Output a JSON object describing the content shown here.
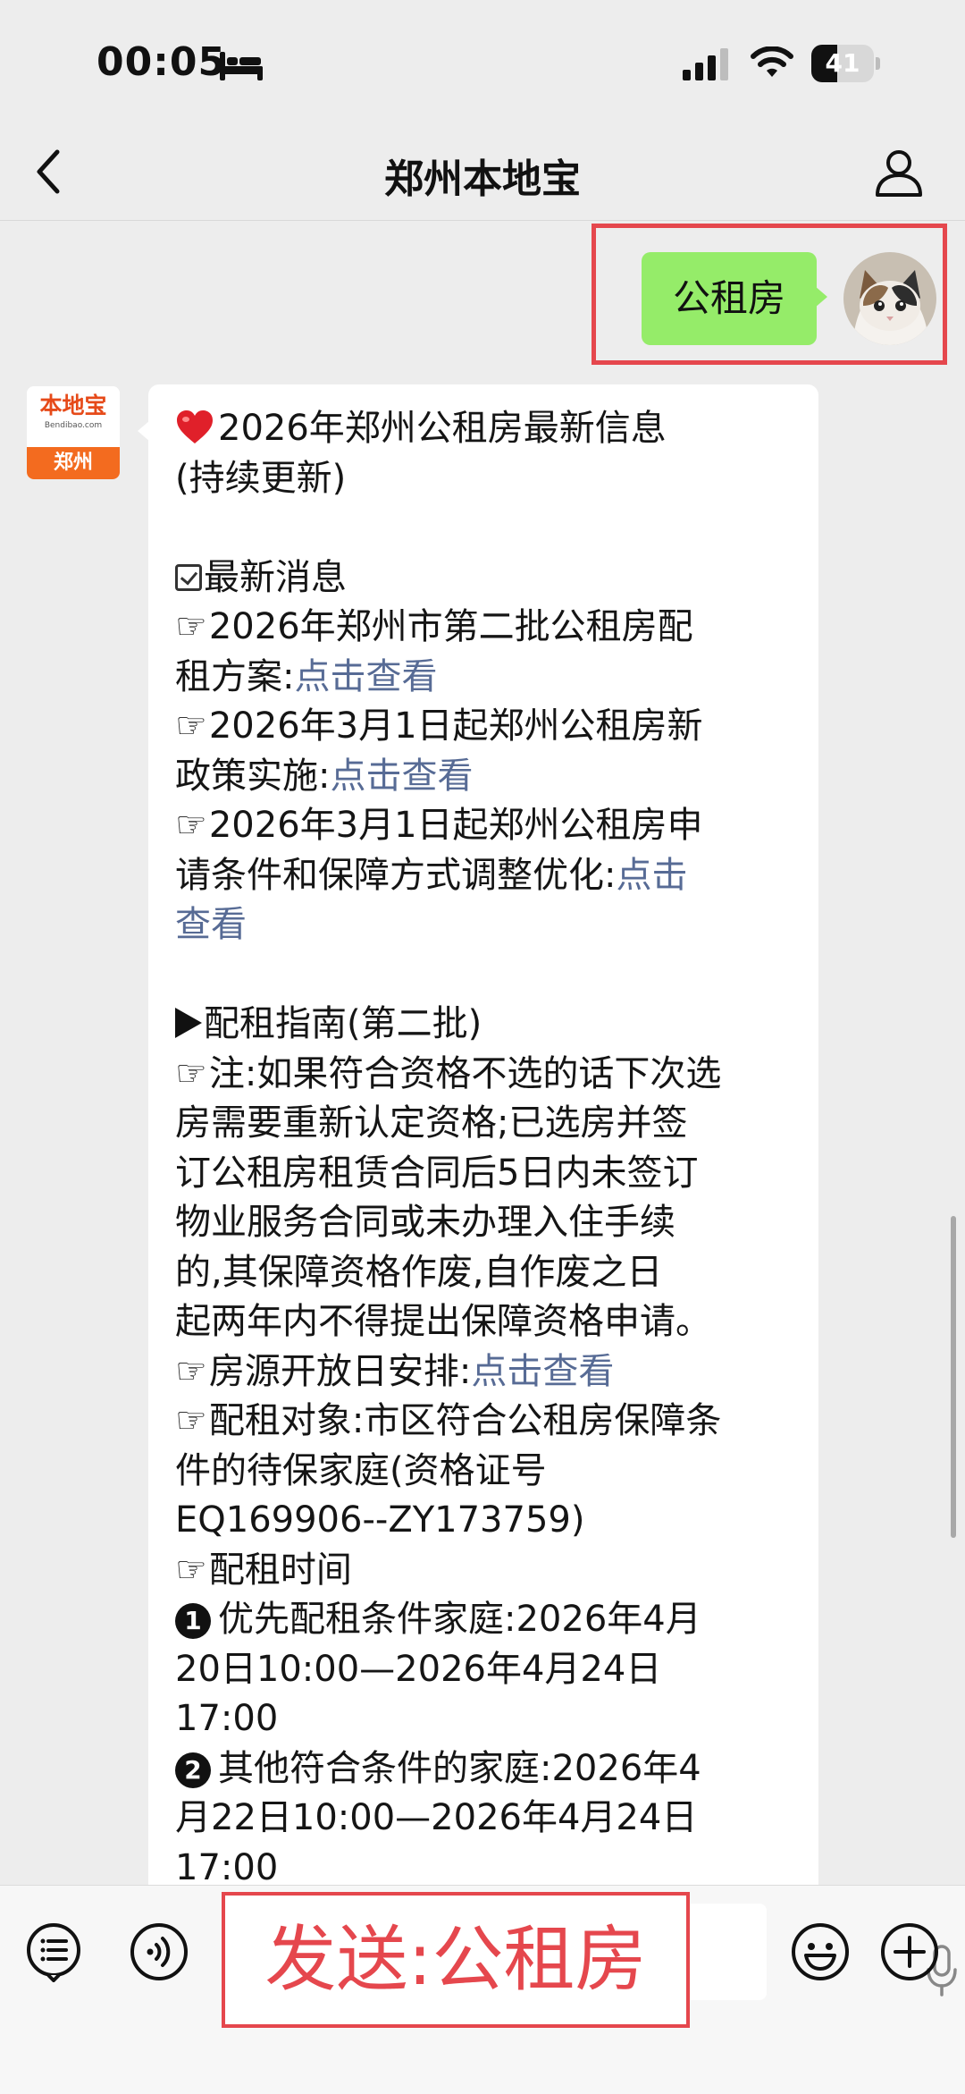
{
  "status_bar": {
    "time": "00:05",
    "battery_level": "41",
    "icons": [
      "bed-icon",
      "signal-icon",
      "wifi-icon",
      "battery-icon"
    ]
  },
  "nav": {
    "title": "郑州本地宝",
    "back_icon": "chevron-left-icon",
    "profile_icon": "person-icon"
  },
  "sent_message": {
    "text": "公租房"
  },
  "bot_avatar": {
    "brand": "本地宝",
    "url": "Bendibao.com",
    "city": "郑州",
    "accent": "#f36b1f"
  },
  "reply": {
    "title_line1": "2026年郑州公租房最新信息",
    "title_line2": "(持续更新)",
    "section1_heading": "最新消息",
    "item1_line1": "2026年郑州市第二批公租房配",
    "item1_line2": "租方案:",
    "item1_link": "点击查看",
    "item2_line1": "2026年3月1日起郑州公租房新",
    "item2_line2": "政策实施:",
    "item2_link": "点击查看",
    "item3_line1": "2026年3月1日起郑州公租房申",
    "item3_line2": "请条件和保障方式调整优化:",
    "item3_link_part1": "点击",
    "item3_link_part2": "查看",
    "section2_heading": "配租指南(第二批)",
    "note_lines": [
      "注:如果符合资格不选的话下次选",
      "房需要重新认定资格;已选房并签",
      "订公租房租赁合同后5日内未签订",
      "物业服务合同或未办理入住手续",
      "的,其保障资格作废,自作废之日",
      "起两年内不得提出保障资格申请。"
    ],
    "house_open_label": "房源开放日安排:",
    "house_open_link": "点击查看",
    "target_lines": [
      "配租对象:市区符合公租房保障条",
      "件的待保家庭(资格证号",
      "EQ169906--ZY173759)"
    ],
    "time_heading": "配租时间",
    "schedule1_badge": "1",
    "schedule1_lines": [
      "优先配租条件家庭:2026年4月",
      "20日10:00—2026年4月24日",
      "17:00"
    ],
    "schedule2_badge": "2",
    "schedule2_lines": [
      "其他符合条件的家庭:2026年4",
      "月22日10:00—2026年4月24日",
      "17:00"
    ]
  },
  "input_bar": {
    "icons": [
      "menu-icon",
      "voice-icon",
      "mic-icon",
      "emoji-icon",
      "plus-icon"
    ]
  },
  "annotation": {
    "send_text": "发送:公租房",
    "color": "#e5474d"
  },
  "colors": {
    "link": "#576b95",
    "sent_bubble": "#95ec69",
    "background": "#ededed"
  }
}
